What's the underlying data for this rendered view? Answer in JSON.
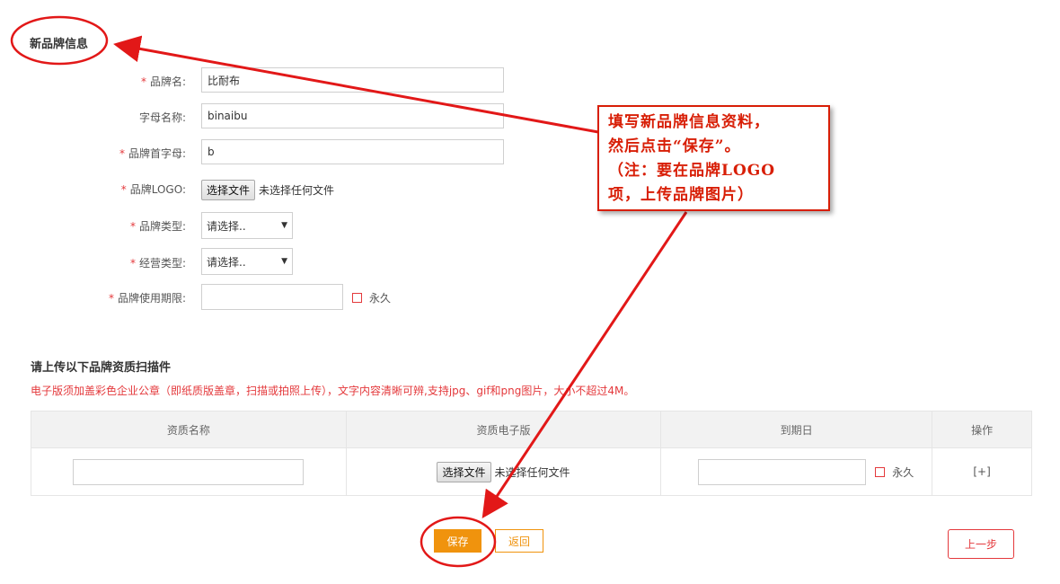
{
  "form": {
    "title": "新品牌信息",
    "fields": {
      "brand_name": {
        "label": "品牌名:",
        "value": "比耐布"
      },
      "letter_name": {
        "label": "字母名称:",
        "value": "binaibu"
      },
      "initial": {
        "label": "品牌首字母:",
        "value": "b"
      },
      "logo": {
        "label": "品牌LOGO:",
        "button": "选择文件",
        "status": "未选择任何文件"
      },
      "brand_type": {
        "label": "品牌类型:",
        "selected": "请选择.."
      },
      "business_type": {
        "label": "经营类型:",
        "selected": "请选择.."
      },
      "expiry": {
        "label": "品牌使用期限:",
        "value": "",
        "permanent_label": "永久"
      }
    },
    "required_mark": "*"
  },
  "upload": {
    "title": "请上传以下品牌资质扫描件",
    "hint": "电子版须加盖彩色企业公章（即纸质版盖章，扫描或拍照上传），文字内容清晰可辨,支持jpg、gif和png图片，大小不超过4M。",
    "table": {
      "headers": [
        "资质名称",
        "资质电子版",
        "到期日",
        "操作"
      ],
      "row": {
        "name": "",
        "file_button": "选择文件",
        "file_status": "未选择任何文件",
        "expiry": "",
        "permanent_label": "永久",
        "action": "[+]"
      }
    }
  },
  "actions": {
    "save": "保存",
    "back": "返回",
    "prev": "上一步"
  },
  "annotation": {
    "lines": [
      "填写新品牌信息资料，",
      "然后点击“保存”。",
      "（注：要在品牌LOGO",
      "项，上传品牌图片）"
    ]
  },
  "colors": {
    "required": "#e4393c",
    "accent": "#f0930d",
    "annotation": "#d81e06"
  }
}
